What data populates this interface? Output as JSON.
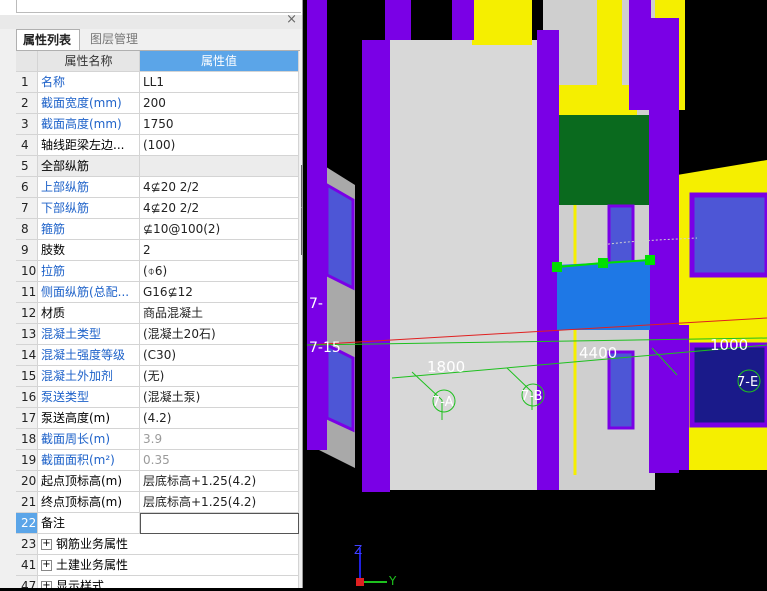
{
  "panel": {
    "close_label": "×",
    "tabs": [
      {
        "label": "属性列表",
        "active": true
      },
      {
        "label": "图层管理",
        "active": false
      }
    ],
    "columns": {
      "name": "属性名称",
      "value": "属性值"
    },
    "rows": [
      {
        "num": "1",
        "name": "名称",
        "value": "LL1"
      },
      {
        "num": "2",
        "name": "截面宽度(mm)",
        "value": "200"
      },
      {
        "num": "3",
        "name": "截面高度(mm)",
        "value": "1750"
      },
      {
        "num": "4",
        "name": "轴线距梁左边...",
        "value": "(100)"
      },
      {
        "num": "5",
        "name": "全部纵筋",
        "value": ""
      },
      {
        "num": "6",
        "name": "上部纵筋",
        "value": "4⊈20 2/2"
      },
      {
        "num": "7",
        "name": "下部纵筋",
        "value": "4⊈20 2/2"
      },
      {
        "num": "8",
        "name": "箍筋",
        "value": "⊈10@100(2)"
      },
      {
        "num": "9",
        "name": "肢数",
        "value": "2"
      },
      {
        "num": "10",
        "name": "拉筋",
        "value": "(⌽6)"
      },
      {
        "num": "11",
        "name": "侧面纵筋(总配...",
        "value": "G16⊈12"
      },
      {
        "num": "12",
        "name": "材质",
        "value": "商品混凝土"
      },
      {
        "num": "13",
        "name": "混凝土类型",
        "value": "(混凝土20石)"
      },
      {
        "num": "14",
        "name": "混凝土强度等级",
        "value": "(C30)"
      },
      {
        "num": "15",
        "name": "混凝土外加剂",
        "value": "(无)"
      },
      {
        "num": "16",
        "name": "泵送类型",
        "value": "(混凝土泵)"
      },
      {
        "num": "17",
        "name": "泵送高度(m)",
        "value": "(4.2)"
      },
      {
        "num": "18",
        "name": "截面周长(m)",
        "value": "3.9"
      },
      {
        "num": "19",
        "name": "截面面积(m²)",
        "value": "0.35"
      },
      {
        "num": "20",
        "name": "起点顶标高(m)",
        "value": "层底标高+1.25(4.2)"
      },
      {
        "num": "21",
        "name": "终点顶标高(m)",
        "value": "层底标高+1.25(4.2)"
      },
      {
        "num": "22",
        "name": "备注",
        "value": ""
      },
      {
        "num": "23",
        "name": "钢筋业务属性",
        "value": "",
        "group": true
      },
      {
        "num": "41",
        "name": "土建业务属性",
        "value": "",
        "group": true
      },
      {
        "num": "47",
        "name": "显示样式",
        "value": "",
        "group": true
      }
    ]
  },
  "viewport": {
    "dimensions": [
      "1800",
      "4400",
      "1000"
    ],
    "axis_labels": [
      "7-",
      "7-15",
      "7-A",
      "7-B",
      "7-E"
    ],
    "axes_triad": {
      "z": "Z",
      "y": "Y"
    },
    "colors": {
      "wall": "#d6d6d6",
      "column": "#7a00e6",
      "yellow": "#f5ef00",
      "beam_selected": "#1e78e6",
      "green": "#0a6a1e",
      "handle": "#00e000"
    }
  }
}
